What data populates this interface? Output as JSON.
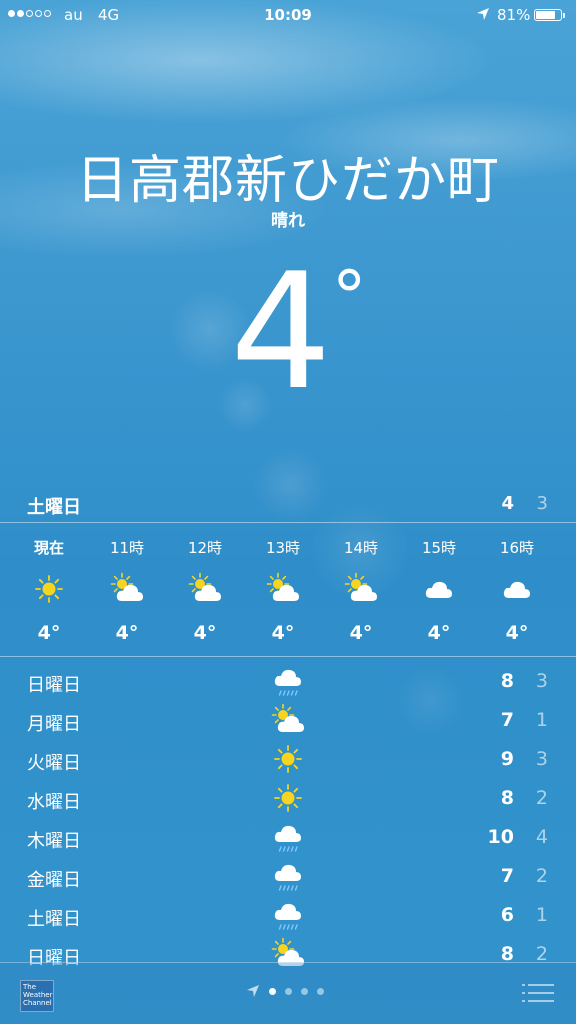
{
  "status_bar": {
    "signal_dots": [
      true,
      true,
      false,
      false,
      false
    ],
    "carrier": "au",
    "network": "4G",
    "time": "10:09",
    "battery_text": "81%",
    "battery_level": 0.81
  },
  "location": {
    "city": "日高郡新ひだか町",
    "condition": "晴れ",
    "temperature": "4",
    "degree_symbol": "°"
  },
  "today": {
    "day": "土曜日",
    "high": "4",
    "low": "3"
  },
  "hourly": [
    {
      "label": "現在",
      "icon": "sun-icon",
      "temp": "4°",
      "bold": true
    },
    {
      "label": "11時",
      "icon": "partly-sunny-icon",
      "temp": "4°"
    },
    {
      "label": "12時",
      "icon": "partly-sunny-icon",
      "temp": "4°"
    },
    {
      "label": "13時",
      "icon": "partly-sunny-icon",
      "temp": "4°"
    },
    {
      "label": "14時",
      "icon": "partly-sunny-icon",
      "temp": "4°"
    },
    {
      "label": "15時",
      "icon": "cloud-icon",
      "temp": "4°"
    },
    {
      "label": "16時",
      "icon": "cloud-icon",
      "temp": "4°"
    }
  ],
  "daily": [
    {
      "day": "日曜日",
      "icon": "rain-icon",
      "high": "8",
      "low": "3"
    },
    {
      "day": "月曜日",
      "icon": "partly-sunny-icon",
      "high": "7",
      "low": "1"
    },
    {
      "day": "火曜日",
      "icon": "sun-icon",
      "high": "9",
      "low": "3"
    },
    {
      "day": "水曜日",
      "icon": "sun-icon",
      "high": "8",
      "low": "2"
    },
    {
      "day": "木曜日",
      "icon": "rain-icon",
      "high": "10",
      "low": "4"
    },
    {
      "day": "金曜日",
      "icon": "rain-icon",
      "high": "7",
      "low": "2"
    },
    {
      "day": "土曜日",
      "icon": "rain-icon",
      "high": "6",
      "low": "1"
    },
    {
      "day": "日曜日",
      "icon": "partly-sunny-icon",
      "high": "8",
      "low": "2"
    }
  ],
  "footer": {
    "logo_text": [
      "The",
      "Weather",
      "Channel"
    ],
    "page_count": 4,
    "active_page": 0
  },
  "colors": {
    "sun": "#f7d51e",
    "cloud": "#ffffff",
    "rain": "#7ec8ff"
  }
}
